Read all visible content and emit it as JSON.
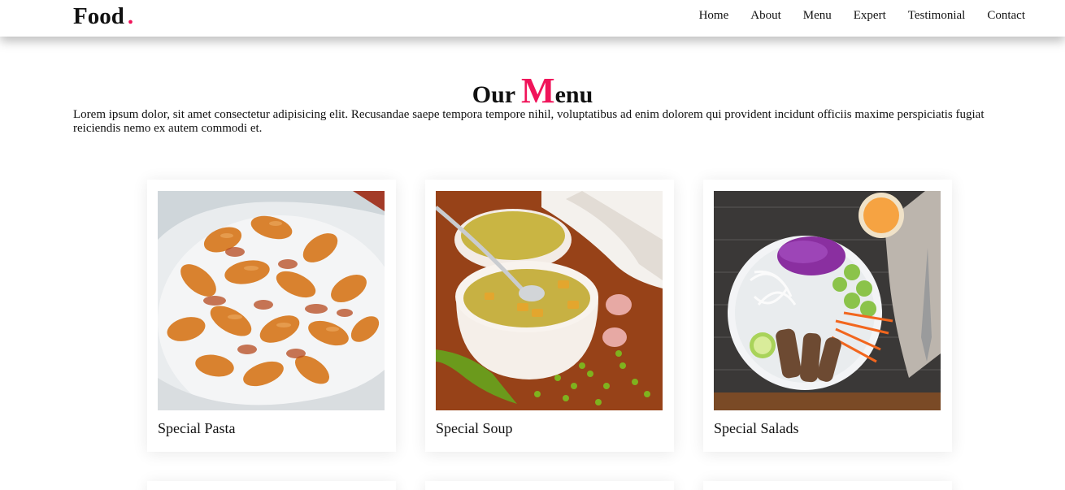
{
  "header": {
    "brand": "Food",
    "brand_dot": ".",
    "nav": [
      "Home",
      "About",
      "Menu",
      "Expert",
      "Testimonial",
      "Contact"
    ]
  },
  "menu_section": {
    "title_prefix": "Our ",
    "title_big_letter": "M",
    "title_rest": "enu",
    "description": "Lorem ipsum dolor, sit amet consectetur adipisicing elit. Recusandae saepe tempora tempore nihil, voluptatibus ad enim dolorem qui provident incidunt officiis maxime perspiciatis fugiat reiciendis nemo ex autem commodi et."
  },
  "cards": [
    {
      "title": "Special Pasta",
      "image": "pasta-photo"
    },
    {
      "title": "Special Soup",
      "image": "soup-photo"
    },
    {
      "title": "Special Salads",
      "image": "salad-photo"
    }
  ],
  "colors": {
    "accent": "#f0145a"
  }
}
